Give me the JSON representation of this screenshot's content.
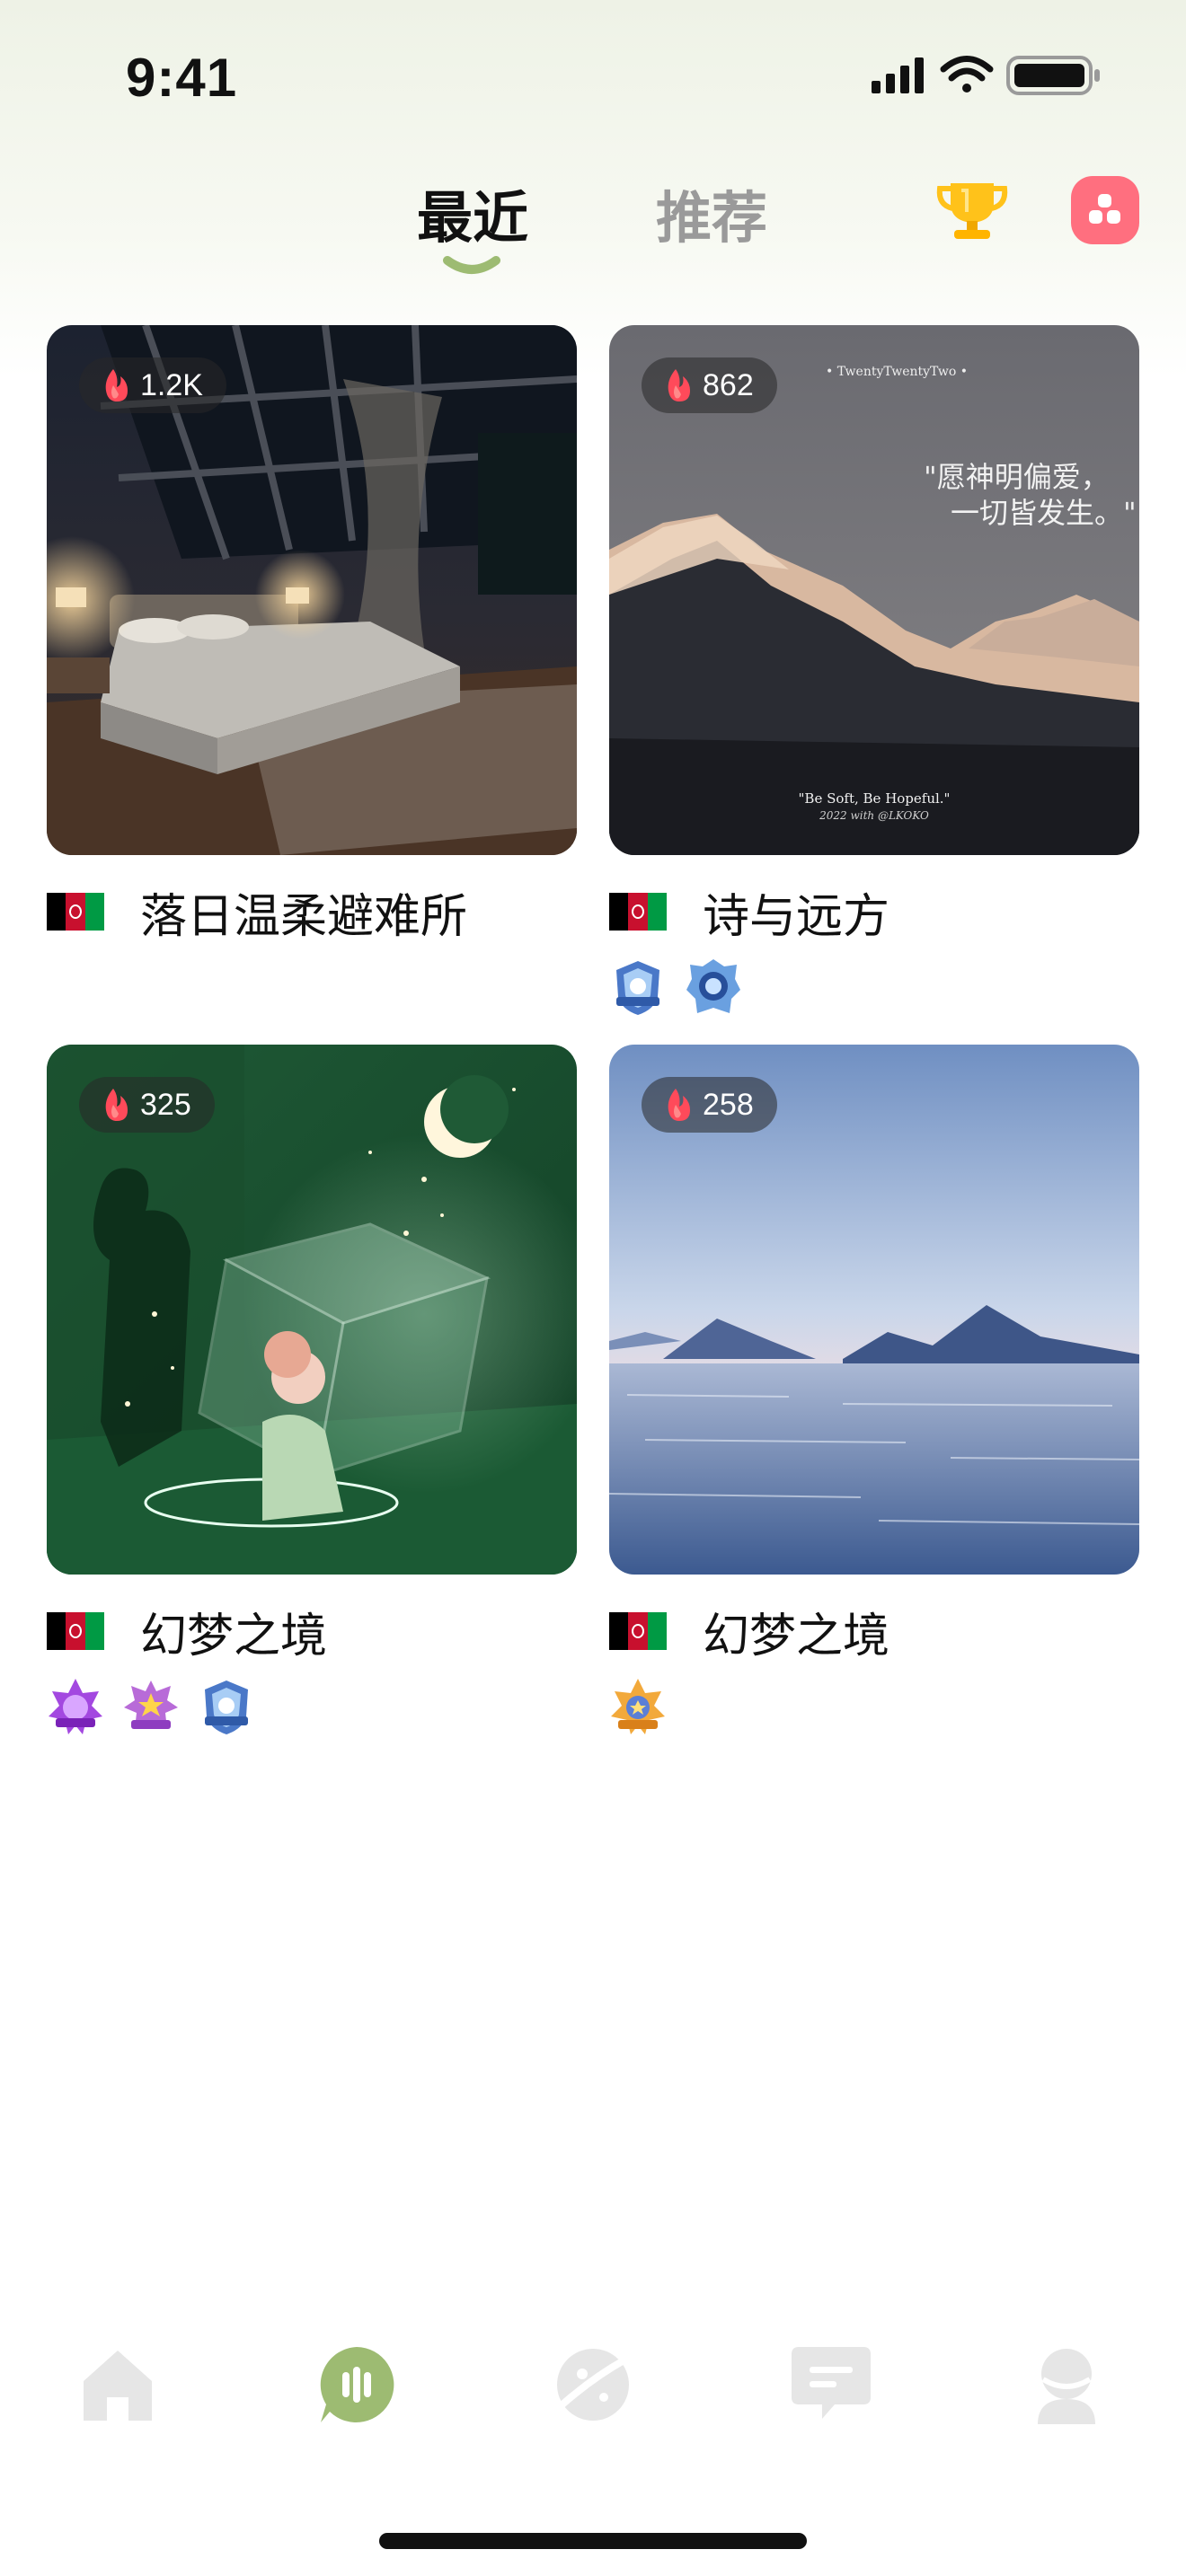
{
  "status_bar": {
    "time": "9:41"
  },
  "top_tabs": [
    {
      "label": "最近",
      "active": true
    },
    {
      "label": "推荐",
      "active": false
    }
  ],
  "accent_color": "#9dbb72",
  "cards": [
    {
      "heat": "1.2K",
      "title": "落日温柔避难所",
      "flag": "afghanistan-flag",
      "badges": []
    },
    {
      "heat": "862",
      "title": "诗与远方",
      "flag": "afghanistan-flag",
      "image_text": {
        "top": "• TwentyTwentyTwo •",
        "calligraphy_line1": "\"愿神明偏爱，",
        "calligraphy_line2": "一切皆发生。\"",
        "quote": "\"Be Soft, Be Hopeful.\"",
        "credit": "2022 with @LKOKO"
      },
      "badges": [
        "blue-shield-badge",
        "blue-crest-badge"
      ]
    },
    {
      "heat": "325",
      "title": "幻梦之境",
      "flag": "afghanistan-flag",
      "badges": [
        "purple-star-badge",
        "purple-crown-badge",
        "blue-shield-badge"
      ]
    },
    {
      "heat": "258",
      "title": "幻梦之境",
      "flag": "afghanistan-flag",
      "badges": [
        "gold-star-badge"
      ]
    }
  ],
  "tabbar": [
    "home-icon",
    "voice-room-icon",
    "planet-icon",
    "message-icon",
    "profile-icon"
  ]
}
